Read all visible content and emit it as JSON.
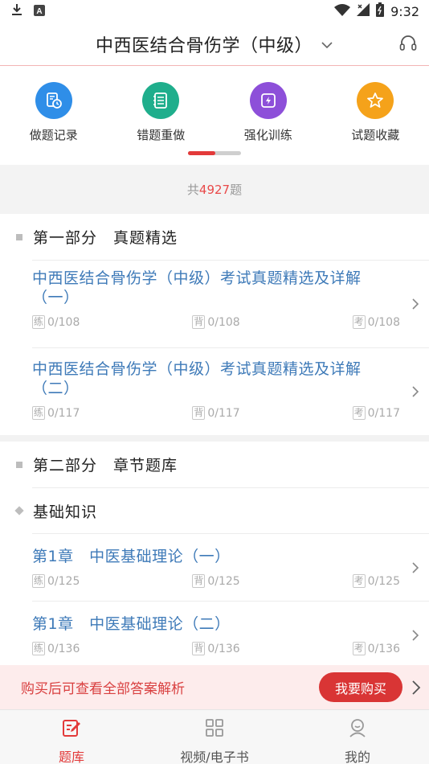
{
  "status_bar": {
    "time": "9:32"
  },
  "header": {
    "title": "中西医结合骨伤学（中级）"
  },
  "quick_actions": [
    {
      "label": "做题记录",
      "icon": "record-icon",
      "color": "#2f8ee8"
    },
    {
      "label": "错题重做",
      "icon": "notebook-icon",
      "color": "#1fae8c"
    },
    {
      "label": "强化训练",
      "icon": "lightning-icon",
      "color": "#8d4fd9"
    },
    {
      "label": "试题收藏",
      "icon": "star-icon",
      "color": "#f5a21a"
    }
  ],
  "count_bar": {
    "prefix": "共",
    "count": "4927",
    "suffix": "题"
  },
  "sections": {
    "part1": {
      "title": "第一部分　真题精选",
      "items": [
        {
          "title": "中西医结合骨伤学（中级）考试真题精选及详解（一）",
          "practice": "0/108",
          "recite": "0/108",
          "exam": "0/108"
        },
        {
          "title": "中西医结合骨伤学（中级）考试真题精选及详解（二）",
          "practice": "0/117",
          "recite": "0/117",
          "exam": "0/117"
        }
      ]
    },
    "part2": {
      "title": "第二部分　章节题库",
      "subsection": "基础知识",
      "items": [
        {
          "title": "第1章　中医基础理论（一）",
          "practice": "0/125",
          "recite": "0/125",
          "exam": "0/125"
        },
        {
          "title": "第1章　中医基础理论（二）",
          "practice": "0/136",
          "recite": "0/136",
          "exam": "0/136"
        }
      ]
    }
  },
  "tags": {
    "practice": "练",
    "recite": "背",
    "exam": "考"
  },
  "buy_banner": {
    "text": "购买后可查看全部答案解析",
    "button": "我要购买"
  },
  "bottom_nav": [
    {
      "label": "题库",
      "active": true
    },
    {
      "label": "视频/电子书",
      "active": false
    },
    {
      "label": "我的",
      "active": false
    }
  ],
  "colors": {
    "accent": "#e33a3a",
    "link": "#3e7ab8",
    "banner_bg": "#fdecec"
  }
}
